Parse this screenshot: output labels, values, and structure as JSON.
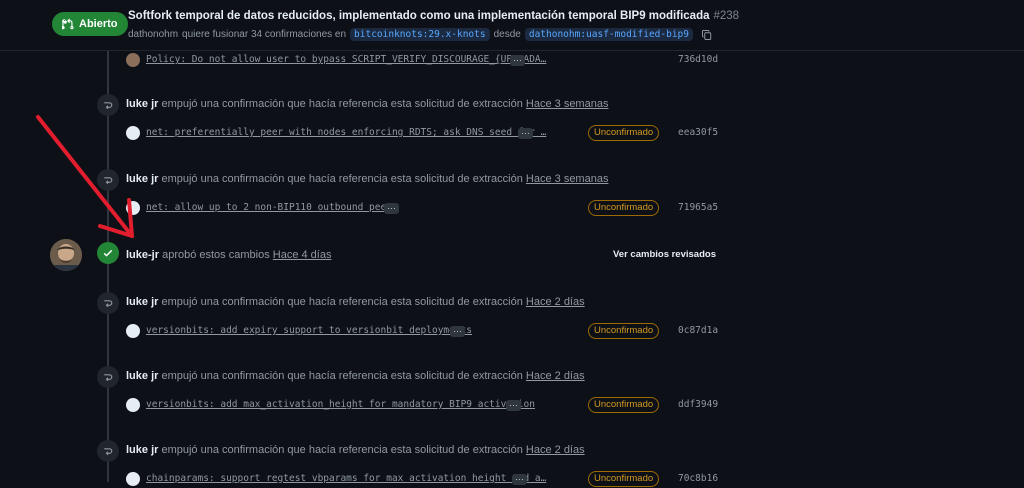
{
  "pr": {
    "state": "Abierto",
    "title": "Softfork temporal de datos reducidos, implementado como una implementación temporal BIP9 modificada",
    "number": "#238",
    "author": "dathonohm",
    "merge_text": "quiere fusionar 34 confirmaciones en",
    "base_branch": "bitcoinknots:29.x-knots",
    "from_text": "desde",
    "head_branch": "dathonohm:uasf-modified-bip9"
  },
  "strings": {
    "pushed": "empujó una confirmación que hacía referencia esta solicitud de extracción",
    "unverified": "Unconfirmado",
    "ellipsis": "…"
  },
  "commit_top": {
    "message": "Policy: Do not allow user to bypass SCRIPT_VERIFY_DISCOURAGE_{UPGRADA…",
    "sha": "736d10d"
  },
  "events": [
    {
      "user": "luke jr",
      "time": "Hace 3 semanas",
      "commit": "net: preferentially peer with nodes enforcing RDTS; ask DNS seed for …",
      "sha": "eea30f5"
    },
    {
      "user": "luke jr",
      "time": "Hace 3 semanas",
      "commit": "net: allow up to 2 non-BIP110 outbound peers",
      "sha": "71965a5"
    },
    {
      "user": "luke jr",
      "time": "Hace 2 días",
      "commit": "versionbits: add expiry support to versionbit deployments",
      "sha": "0c87d1a"
    },
    {
      "user": "luke jr",
      "time": "Hace 2 días",
      "commit": "versionbits: add max_activation_height for mandatory BIP9 activation",
      "sha": "ddf3949"
    },
    {
      "user": "luke jr",
      "time": "Hace 2 días",
      "commit": "chainparams: support regtest vbparams for max activation height and a…",
      "sha": "70c8b16"
    }
  ],
  "review": {
    "user": "luke-jr",
    "action": "aprobó estos cambios",
    "time": "Hace 4 días",
    "view_changes": "Ver cambios revisados"
  },
  "colors": {
    "open_badge": "#238636",
    "unverified": "#d29922",
    "link": "#58a6ff",
    "annotation_arrow": "#e11d2e"
  }
}
